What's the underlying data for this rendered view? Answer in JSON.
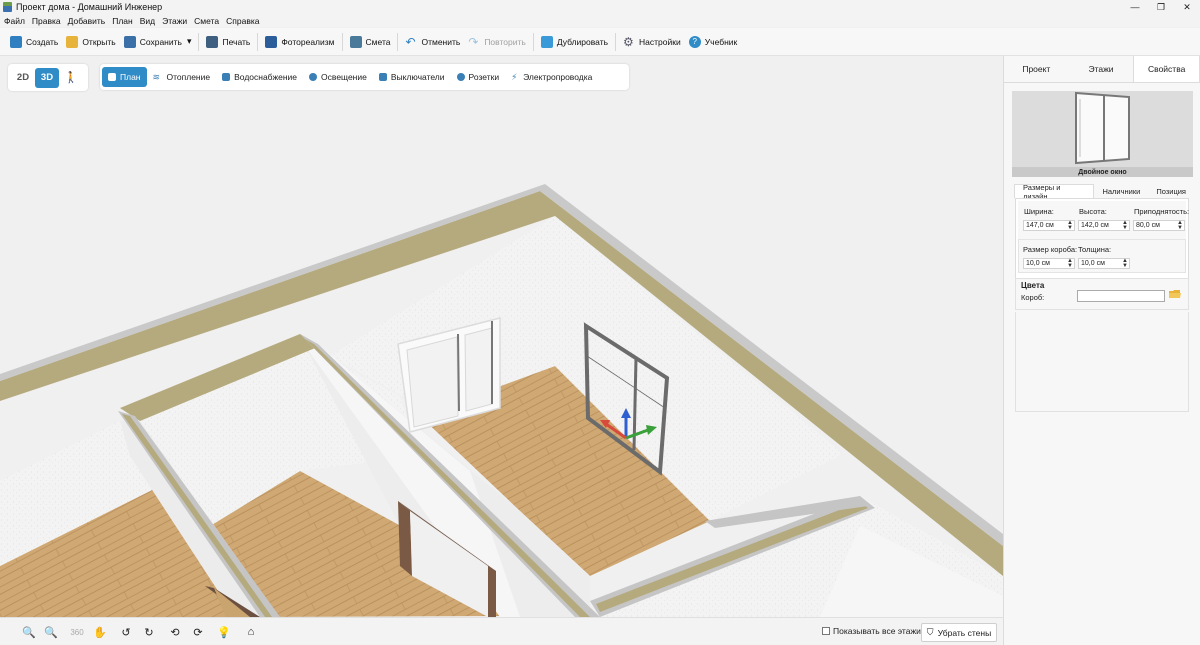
{
  "window": {
    "title": "Проект дома - Домашний Инженер",
    "controls": [
      "—",
      "❐",
      "✕"
    ]
  },
  "menu": [
    "Файл",
    "Правка",
    "Добавить",
    "План",
    "Вид",
    "Этажи",
    "Смета",
    "Справка"
  ],
  "toolbar": {
    "create": "Создать",
    "open": "Открыть",
    "save": "Сохранить",
    "save_dropdown": "▾",
    "print": "Печать",
    "photorealism": "Фотореализм",
    "estimate": "Смета",
    "undo": "Отменить",
    "redo": "Повторить",
    "duplicate": "Дублировать",
    "settings": "Настройки",
    "tutorial": "Учебник"
  },
  "view_modes": {
    "mode_2d": "2D",
    "mode_3d": "3D",
    "active": "3D"
  },
  "layers": {
    "plan": "План",
    "heating": "Отопление",
    "water": "Водоснабжение",
    "lighting": "Освещение",
    "switches": "Выключатели",
    "sockets": "Розетки",
    "wiring": "Электропроводка"
  },
  "bottom": {
    "show_all_floors": "Показывать все этажи",
    "remove_walls": "Убрать стены",
    "show_all_checked": false
  },
  "panel": {
    "tabs": {
      "project": "Проект",
      "floors": "Этажи",
      "properties": "Свойства"
    },
    "preview_caption": "Двойное окно",
    "sub_tabs": {
      "sizes": "Размеры и дизайн",
      "trims": "Наличники",
      "position": "Позиция"
    },
    "fields": {
      "width_label": "Ширина:",
      "width_value": "147,0 см",
      "height_label": "Высота:",
      "height_value": "142,0 см",
      "elevation_label": "Приподнятость:",
      "elevation_value": "80,0 см",
      "frame_size_label": "Размер короба:",
      "frame_size_value": "10,0 см",
      "thickness_label": "Толщина:",
      "thickness_value": "10,0 см"
    },
    "colors": {
      "section_title": "Цвета",
      "box_label": "Короб:"
    }
  },
  "colors": {
    "accent": "#2f8cc6",
    "wall_top": "#b5aa7e",
    "floor": "#c9a46e",
    "wall": "#f4f4f4"
  }
}
